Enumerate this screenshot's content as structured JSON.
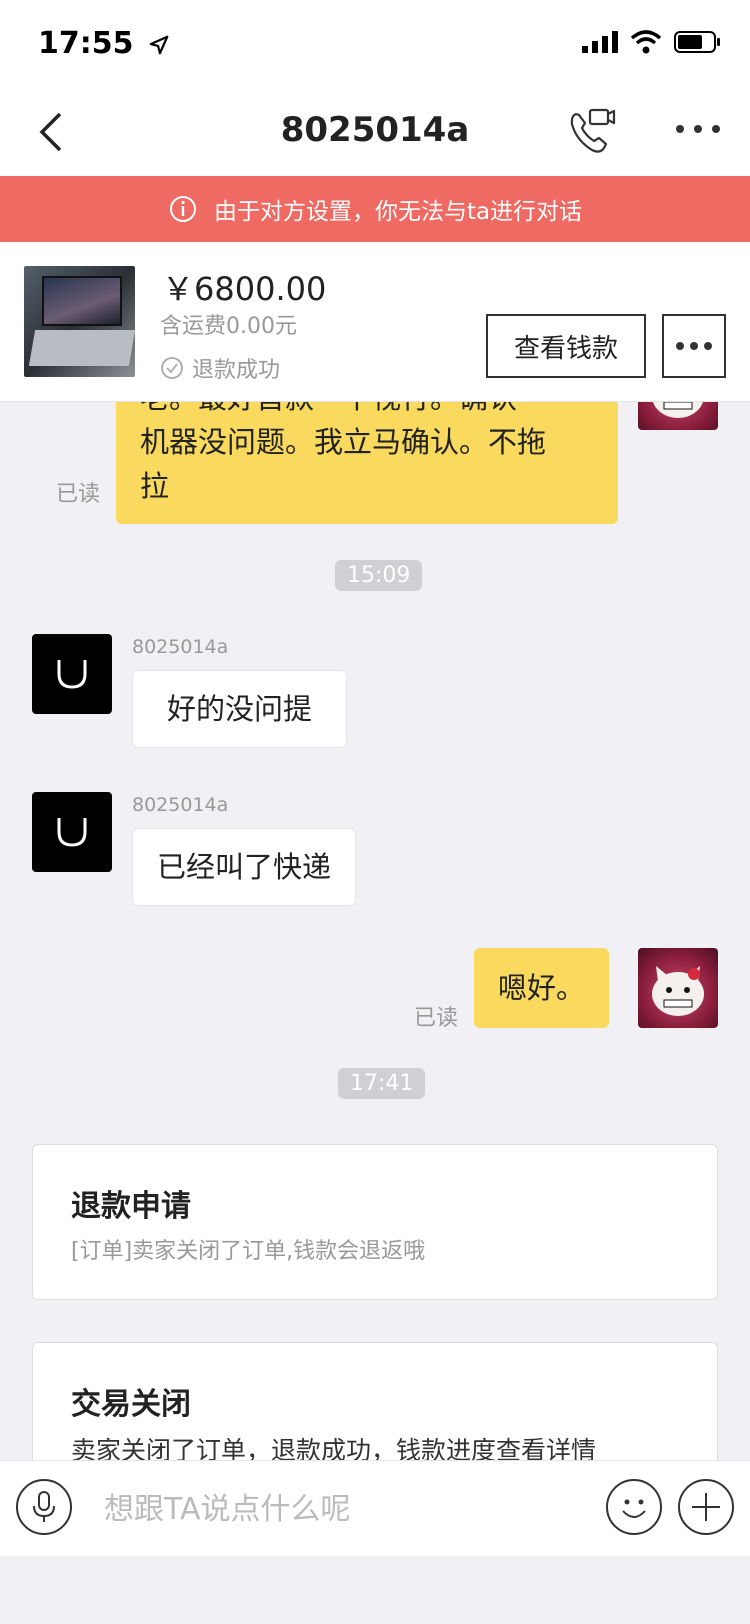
{
  "status": {
    "time": "17:55"
  },
  "nav": {
    "title": "8025014a"
  },
  "banner": {
    "text": "由于对方设置，你无法与ta进行对话"
  },
  "product": {
    "price": "￥6800.00",
    "shipping": "含运费0.00元",
    "status": "退款成功",
    "view_button": "查看钱款"
  },
  "messages": {
    "first_bubble_partial": "老。最好首款一下视行。确认",
    "first_bubble_line2": "机器没问题。我立马确认。不拖",
    "first_bubble_line3": "拉",
    "read_label": "已读",
    "time1": "15:09",
    "sender_name": "8025014a",
    "msg_ok": "好的没问提",
    "msg_express": "已经叫了快递",
    "msg_reply": "嗯好。",
    "time2": "17:41"
  },
  "cards": {
    "refund_title": "退款申请",
    "refund_sub": "[订单]卖家关闭了订单,钱款会退返哦",
    "closed_title": "交易关闭",
    "closed_sub": "卖家关闭了订单，退款成功，钱款进度查看详情"
  },
  "input": {
    "placeholder": "想跟TA说点什么呢"
  }
}
